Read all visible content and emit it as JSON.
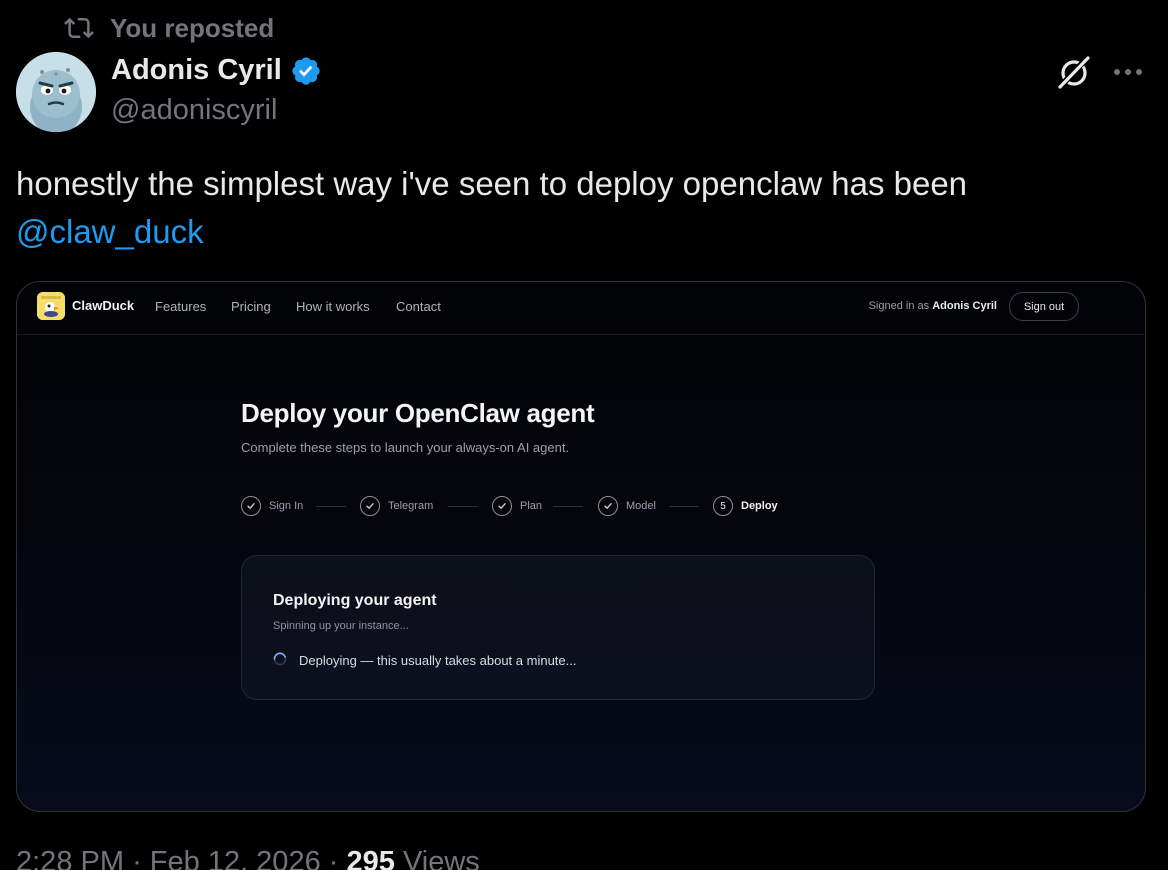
{
  "repost": {
    "text": "You reposted"
  },
  "author": {
    "name": "Adonis Cyril",
    "handle": "@adoniscyril"
  },
  "tweet": {
    "text": "honestly the simplest way i've seen to deploy openclaw has been",
    "mention": "@claw_duck"
  },
  "icons": {
    "repost": "repost-icon",
    "verified": "verified-badge-icon",
    "grok": "grok-icon",
    "more": "more-icon"
  },
  "colors": {
    "link": "#1d9bf0",
    "muted": "#71767b",
    "text": "#e7e9ea",
    "background": "#000000"
  },
  "embed": {
    "nav": {
      "brand": "ClawDuck",
      "links": [
        "Features",
        "Pricing",
        "How it works",
        "Contact"
      ],
      "signed_in_prefix": "Signed in as",
      "signed_in_name": "Adonis Cyril",
      "signout": "Sign out"
    },
    "title": "Deploy your OpenClaw agent",
    "subtitle": "Complete these steps to launch your always-on AI agent.",
    "steps": [
      {
        "label": "Sign In",
        "done": true
      },
      {
        "label": "Telegram",
        "done": true
      },
      {
        "label": "Plan",
        "done": true
      },
      {
        "label": "Model",
        "done": true
      },
      {
        "label": "Deploy",
        "done": false,
        "number": "5"
      }
    ],
    "card": {
      "title": "Deploying your agent",
      "subtitle": "Spinning up your instance...",
      "status": "Deploying — this usually takes about a minute..."
    }
  },
  "meta": {
    "time": "2:28 PM",
    "date": "Feb 12, 2026",
    "views_count": "295",
    "views_label": "Views"
  }
}
